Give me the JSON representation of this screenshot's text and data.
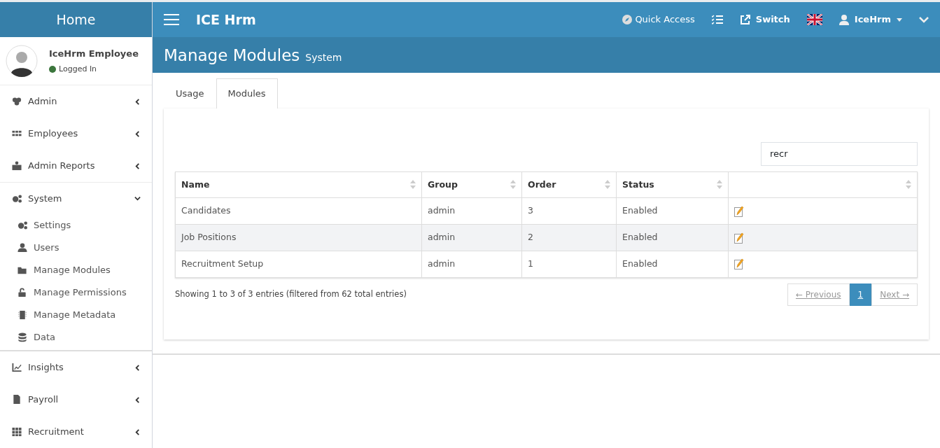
{
  "sidebar": {
    "brand": "Home",
    "user": {
      "name": "IceHrm Employee",
      "status": "Logged In",
      "online": true
    },
    "items": [
      {
        "label": "Admin",
        "expanded": false
      },
      {
        "label": "Employees",
        "expanded": false
      },
      {
        "label": "Admin Reports",
        "expanded": false
      },
      {
        "label": "System",
        "expanded": true,
        "children": [
          {
            "label": "Settings"
          },
          {
            "label": "Users"
          },
          {
            "label": "Manage Modules"
          },
          {
            "label": "Manage Permissions"
          },
          {
            "label": "Manage Metadata"
          },
          {
            "label": "Data"
          }
        ]
      },
      {
        "label": "Insights",
        "expanded": false
      },
      {
        "label": "Payroll",
        "expanded": false
      },
      {
        "label": "Recruitment",
        "expanded": false
      }
    ]
  },
  "topbar": {
    "title": "ICE Hrm",
    "quick_access": "Quick Access",
    "switch": "Switch",
    "user": "IceHrm"
  },
  "page_header": {
    "title": "Manage Modules",
    "subtitle": "System"
  },
  "tabs": [
    {
      "label": "Usage",
      "selected": false
    },
    {
      "label": "Modules",
      "selected": true
    }
  ],
  "search": {
    "value": "recr"
  },
  "table": {
    "columns": [
      "Name",
      "Group",
      "Order",
      "Status"
    ],
    "rows": [
      [
        "Candidates",
        "admin",
        "3",
        "Enabled"
      ],
      [
        "Job Positions",
        "admin",
        "2",
        "Enabled"
      ],
      [
        "Recruitment Setup",
        "admin",
        "1",
        "Enabled"
      ]
    ]
  },
  "info": "Showing 1 to 3 of 3 entries (filtered from 62 total entries)",
  "pagination": [
    {
      "label": "← Previous",
      "selected": false,
      "disabled": true
    },
    {
      "label": "1",
      "selected": true,
      "disabled": false
    },
    {
      "label": "Next →",
      "selected": false,
      "disabled": true
    }
  ]
}
